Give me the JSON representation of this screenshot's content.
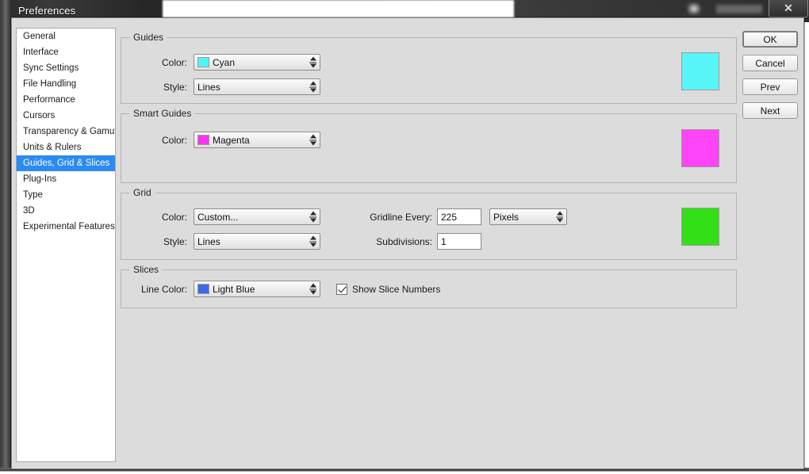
{
  "background_window": {
    "close_button_label": "✕"
  },
  "dialog": {
    "title": "Preferences",
    "sidebar": {
      "items": [
        {
          "label": "General",
          "selected": false
        },
        {
          "label": "Interface",
          "selected": false
        },
        {
          "label": "Sync Settings",
          "selected": false
        },
        {
          "label": "File Handling",
          "selected": false
        },
        {
          "label": "Performance",
          "selected": false
        },
        {
          "label": "Cursors",
          "selected": false
        },
        {
          "label": "Transparency & Gamut",
          "selected": false
        },
        {
          "label": "Units & Rulers",
          "selected": false
        },
        {
          "label": "Guides, Grid & Slices",
          "selected": true
        },
        {
          "label": "Plug-Ins",
          "selected": false
        },
        {
          "label": "Type",
          "selected": false
        },
        {
          "label": "3D",
          "selected": false
        },
        {
          "label": "Experimental Features",
          "selected": false
        }
      ]
    },
    "buttons": [
      {
        "label": "OK",
        "default": true
      },
      {
        "label": "Cancel",
        "default": false
      },
      {
        "label": "Prev",
        "default": false
      },
      {
        "label": "Next",
        "default": false
      }
    ],
    "groups": {
      "guides": {
        "legend": "Guides",
        "color_label": "Color:",
        "color_value": "Cyan",
        "color_swatch": "#50F4F8",
        "style_label": "Style:",
        "style_value": "Lines",
        "preview_color": "#58F5F8"
      },
      "smart_guides": {
        "legend": "Smart Guides",
        "color_label": "Color:",
        "color_value": "Magenta",
        "color_swatch": "#FF33F2",
        "preview_color": "#FF44F8"
      },
      "grid": {
        "legend": "Grid",
        "color_label": "Color:",
        "color_value": "Custom...",
        "style_label": "Style:",
        "style_value": "Lines",
        "gridline_every_label": "Gridline Every:",
        "gridline_every_value": "225",
        "gridline_units_value": "Pixels",
        "subdivisions_label": "Subdivisions:",
        "subdivisions_value": "1",
        "preview_color": "#33E017"
      },
      "slices": {
        "legend": "Slices",
        "line_color_label": "Line Color:",
        "line_color_value": "Light Blue",
        "line_color_swatch": "#3B6BE8",
        "show_slice_numbers_label": "Show Slice Numbers",
        "show_slice_numbers_checked": true
      }
    }
  }
}
